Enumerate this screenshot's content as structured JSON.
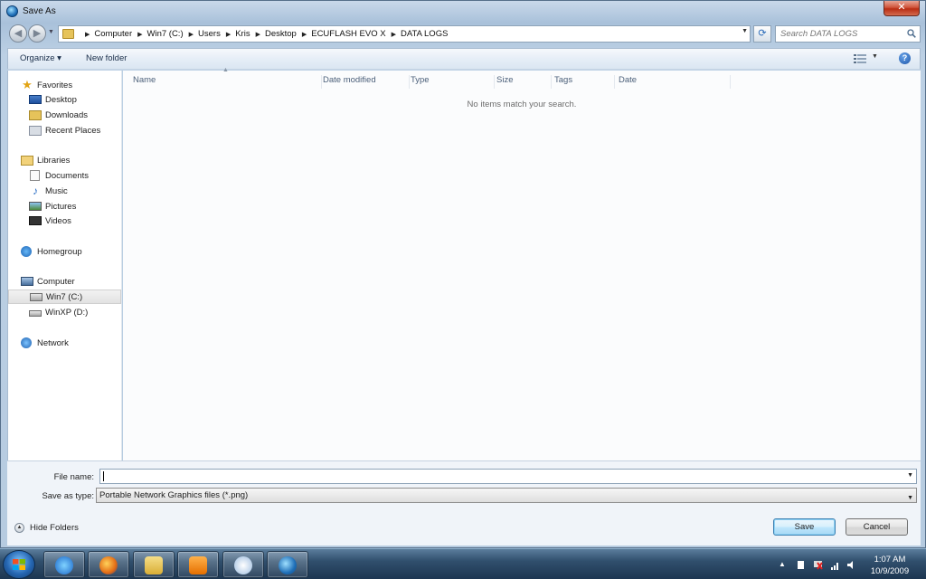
{
  "window": {
    "title": "Save As",
    "close_glyph": "✕"
  },
  "address": {
    "crumbs": [
      "Computer",
      "Win7 (C:)",
      "Users",
      "Kris",
      "Desktop",
      "ECUFLASH EVO X",
      "DATA LOGS"
    ],
    "search_placeholder": "Search DATA LOGS"
  },
  "commandbar": {
    "organize": "Organize ▾",
    "new_folder": "New folder",
    "help": "?"
  },
  "nav": {
    "favorites": "Favorites",
    "desktop": "Desktop",
    "downloads": "Downloads",
    "recent": "Recent Places",
    "libraries": "Libraries",
    "documents": "Documents",
    "music": "Music",
    "pictures": "Pictures",
    "videos": "Videos",
    "homegroup": "Homegroup",
    "computer": "Computer",
    "win7": "Win7 (C:)",
    "winxp": "WinXP (D:)",
    "network": "Network"
  },
  "columns": [
    "Name",
    "Date modified",
    "Type",
    "Size",
    "Tags",
    "Date"
  ],
  "empty_message": "No items match your search.",
  "form": {
    "file_name_label": "File name:",
    "file_name_value": "",
    "save_type_label": "Save as type:",
    "save_type_value": "Portable Network Graphics files (*.png)"
  },
  "footer": {
    "hide_folders": "Hide Folders",
    "save": "Save",
    "cancel": "Cancel"
  },
  "taskbar": {
    "time": "1:07 AM",
    "date": "10/9/2009"
  },
  "colors": {
    "accent": "#3c7fb1",
    "taskbar": "#304f6d",
    "close": "#c8432a"
  },
  "icons": [
    "favorites-star-icon",
    "desktop-icon",
    "downloads-icon",
    "recent-places-icon",
    "libraries-icon",
    "documents-icon",
    "music-icon",
    "pictures-icon",
    "videos-icon",
    "homegroup-icon",
    "computer-icon",
    "drive-icon",
    "network-icon",
    "search-icon",
    "help-icon",
    "views-icon"
  ]
}
